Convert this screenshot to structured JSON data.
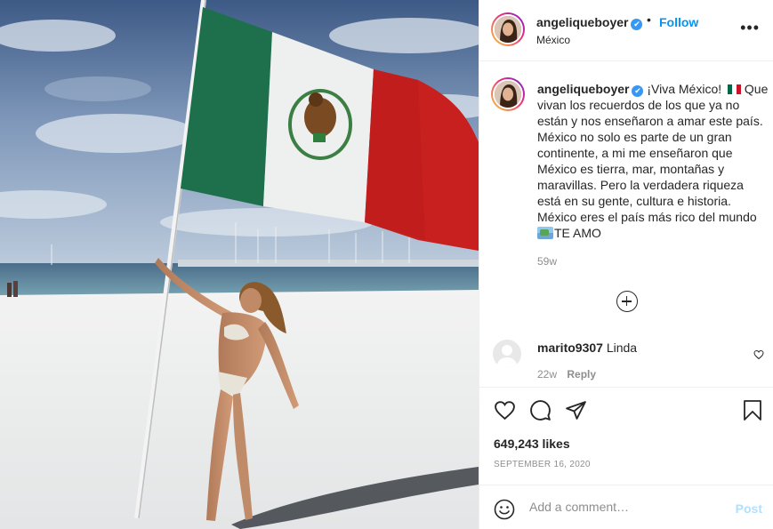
{
  "colors": {
    "accent": "#0095f6",
    "verified": "#3897f0",
    "muted": "#8e8e8e",
    "post_disabled": "#b2dffc"
  },
  "photo": {
    "description_icon": "photo-image"
  },
  "header": {
    "username": "angeliqueboyer",
    "verified_icon": "✔",
    "separator": "•",
    "follow_label": "Follow",
    "location": "México",
    "more_icon": "•••"
  },
  "caption": {
    "username": "angeliqueboyer",
    "verified_icon": "✔",
    "text_part1": "¡Viva México! ",
    "text_part2": "Que vivan los recuerdos de los que ya no están y nos enseñaron a amar este país. México no solo es parte de un gran continente, a mi me enseñaron que México es tierra, mar, montañas y maravillas. Pero la verdadera riqueza está en su gente, cultura e historia. México eres el país más rico del mundo ",
    "text_part3": "TE AMO",
    "time_ago": "59w"
  },
  "comments": [
    {
      "username": "marito9307",
      "text": "Linda",
      "time_ago": "22w",
      "reply_label": "Reply"
    }
  ],
  "actions": {
    "like_icon": "heart-icon",
    "comment_icon": "comment-icon",
    "share_icon": "share-icon",
    "save_icon": "bookmark-icon"
  },
  "likes": "649,243 likes",
  "date": "SEPTEMBER 16, 2020",
  "add_comment": {
    "placeholder": "Add a comment…",
    "post_label": "Post"
  }
}
